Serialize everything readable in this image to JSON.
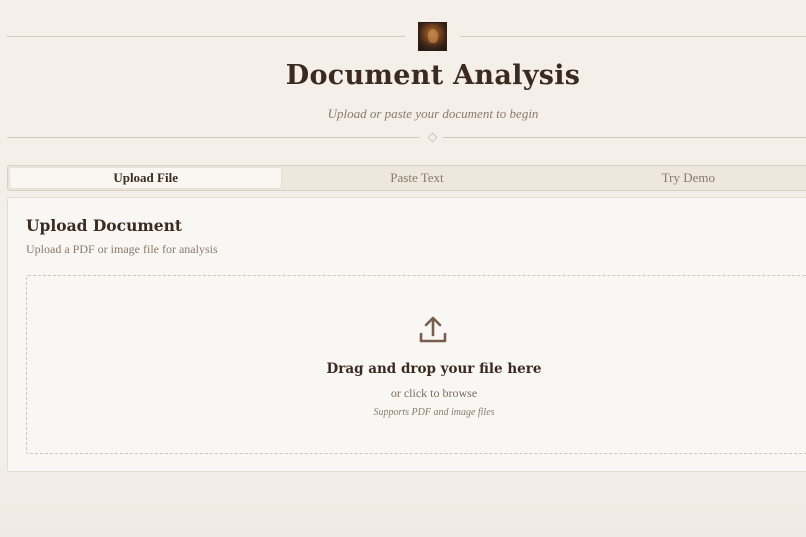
{
  "header": {
    "title": "Document Analysis",
    "subtitle": "Upload or paste your document to begin"
  },
  "tabs": [
    {
      "label": "Upload File",
      "active": true
    },
    {
      "label": "Paste Text",
      "active": false
    },
    {
      "label": "Try Demo",
      "active": false
    }
  ],
  "upload_card": {
    "title": "Upload Document",
    "description": "Upload a PDF or image file for analysis",
    "dropzone": {
      "icon": "upload-icon",
      "title": "Drag and drop your file here",
      "browse": "or click to browse",
      "support": "Supports PDF and image files"
    }
  },
  "colors": {
    "background": "#f4efe8",
    "text_primary": "#3b2a20",
    "text_muted": "#8a7968",
    "accent_icon": "#7a5c4c"
  }
}
